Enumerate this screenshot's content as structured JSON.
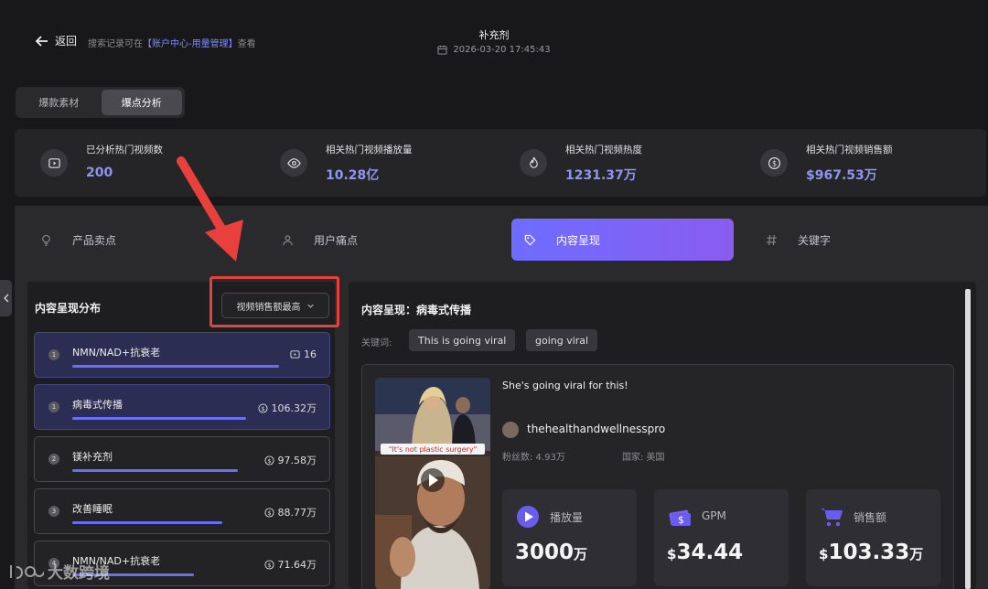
{
  "header": {
    "back_label": "返回",
    "note_prefix": "搜索记录可在",
    "note_link": "【账户中心-用量管理】",
    "note_suffix": "查看",
    "title": "补充剂",
    "datetime": "2026-03-20 17:45:43"
  },
  "tabs": [
    {
      "label": "爆款素材",
      "active": false
    },
    {
      "label": "爆点分析",
      "active": true
    }
  ],
  "stats": [
    {
      "label": "已分析热门视频数",
      "value": "200",
      "icon": "video-icon"
    },
    {
      "label": "相关热门视频播放量",
      "value": "10.28亿",
      "icon": "eye-icon"
    },
    {
      "label": "相关热门视频热度",
      "value": "1231.37万",
      "icon": "flame-icon"
    },
    {
      "label": "相关热门视频销售额",
      "value": "$967.53万",
      "icon": "dollar-icon"
    }
  ],
  "categories": [
    {
      "label": "产品卖点",
      "icon": "bulb-icon",
      "active": false
    },
    {
      "label": "用户痛点",
      "icon": "user-icon",
      "active": false
    },
    {
      "label": "内容呈现",
      "icon": "tag-icon",
      "active": true
    },
    {
      "label": "关键字",
      "icon": "hash-icon",
      "active": false
    }
  ],
  "left_panel": {
    "title": "内容呈现分布",
    "sort_label": "视频销售额最高",
    "rows": [
      {
        "rank": "1",
        "name": "NMN/NAD+抗衰老",
        "metric": "16",
        "metric_icon": "video-icon",
        "bar": 0.7,
        "highlight": true
      },
      {
        "rank": "1",
        "name": "病毒式传播",
        "metric": "106.32万",
        "metric_icon": "dollar-icon",
        "bar": 0.59,
        "highlight": true
      },
      {
        "rank": "2",
        "name": "镁补充剂",
        "metric": "97.58万",
        "metric_icon": "dollar-icon",
        "bar": 0.55,
        "highlight": false
      },
      {
        "rank": "3",
        "name": "改善睡眠",
        "metric": "88.77万",
        "metric_icon": "dollar-icon",
        "bar": 0.5,
        "highlight": false
      },
      {
        "rank": "4",
        "name": "NMN/NAD+抗衰老",
        "metric": "71.64万",
        "metric_icon": "dollar-icon",
        "bar": 0.4,
        "highlight": false
      }
    ]
  },
  "right_panel": {
    "title": "内容呈现：病毒式传播",
    "keywords_label": "关键词:",
    "keywords": [
      "This is going viral",
      "going viral"
    ],
    "video": {
      "thumb_caption": "\"It's not plastic surgery\"",
      "caption": "She's going viral for this!",
      "username": "thehealthandwellnesspro",
      "fans": "粉丝数: 4.93万",
      "country": "国家: 美国",
      "metrics": [
        {
          "label": "播放量",
          "value": "3000",
          "unit": "万",
          "prefix": "",
          "icon": "play-circle-icon"
        },
        {
          "label": "GPM",
          "value": "34.44",
          "unit": "",
          "prefix": "$",
          "icon": "money-icon"
        },
        {
          "label": "销售额",
          "value": "103.33",
          "unit": "万",
          "prefix": "$",
          "icon": "cart-icon"
        }
      ]
    }
  },
  "watermark": "大数跨境",
  "colors": {
    "accent": "#6d6dff",
    "value": "#8e95f0",
    "annotation": "#e8403d"
  }
}
